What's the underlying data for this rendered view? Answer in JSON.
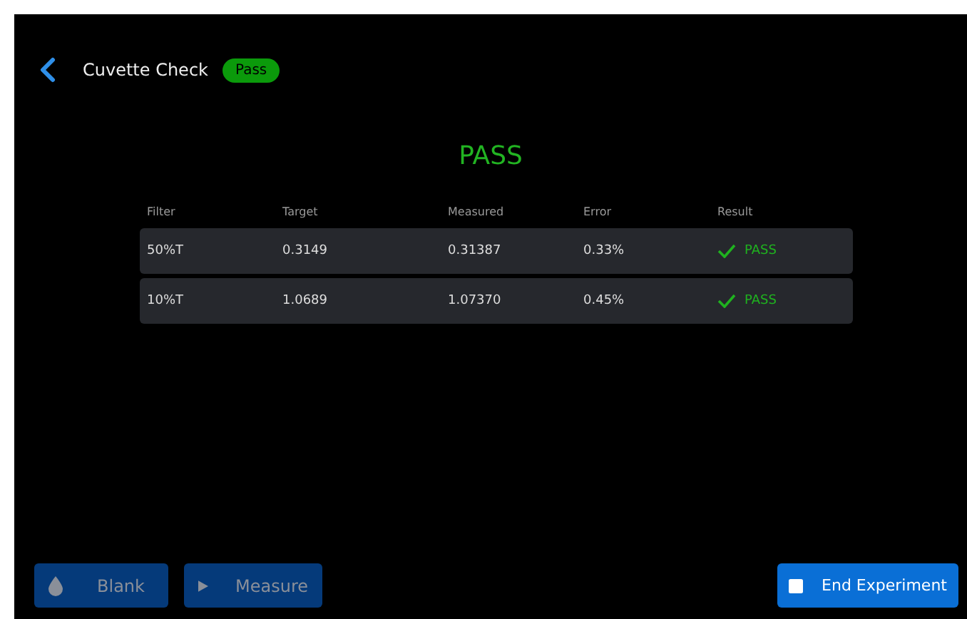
{
  "header": {
    "title": "Cuvette Check",
    "badge": "Pass"
  },
  "result_title": "PASS",
  "table": {
    "columns": [
      "Filter",
      "Target",
      "Measured",
      "Error",
      "Result"
    ],
    "rows": [
      {
        "cells": [
          "50%T",
          "0.3149",
          "0.31387",
          "0.33%"
        ],
        "result": "PASS"
      },
      {
        "cells": [
          "10%T",
          "1.0689",
          "1.07370",
          "0.45%"
        ],
        "result": "PASS"
      }
    ]
  },
  "buttons": [
    {
      "label": "Blank",
      "kind": "drop",
      "disabled": true
    },
    {
      "label": "Measure",
      "kind": "play",
      "disabled": true
    },
    {
      "label": "End Experiment",
      "kind": "stop",
      "disabled": false
    }
  ]
}
